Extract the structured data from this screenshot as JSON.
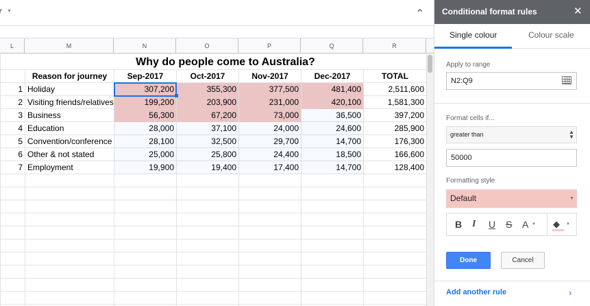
{
  "toolbar": {
    "collapse_icon": "chevron-up-icon"
  },
  "sheet": {
    "title": "Why do people come to Australia?",
    "columns": [
      "L",
      "M",
      "N",
      "O",
      "P",
      "Q",
      "R"
    ],
    "headers": {
      "reason": "Reason for journey",
      "n": "Sep-2017",
      "o": "Oct-2017",
      "p": "Nov-2017",
      "q": "Dec-2017",
      "r": "TOTAL"
    },
    "rows": [
      {
        "idx": "1",
        "reason": "Holiday",
        "n": "307,200",
        "o": "355,300",
        "p": "377,500",
        "q": "481,400",
        "r": "2,511,600"
      },
      {
        "idx": "2",
        "reason": "Visiting friends/relatives",
        "n": "199,200",
        "o": "203,900",
        "p": "231,000",
        "q": "420,100",
        "r": "1,581,300"
      },
      {
        "idx": "3",
        "reason": "Business",
        "n": "56,300",
        "o": "67,200",
        "p": "73,000",
        "q": "36,500",
        "r": "397,200"
      },
      {
        "idx": "4",
        "reason": "Education",
        "n": "28,000",
        "o": "37,100",
        "p": "24,000",
        "q": "24,600",
        "r": "285,900"
      },
      {
        "idx": "5",
        "reason": "Convention/conference",
        "n": "28,100",
        "o": "32,500",
        "p": "29,700",
        "q": "14,700",
        "r": "176,300"
      },
      {
        "idx": "6",
        "reason": "Other & not stated",
        "n": "25,000",
        "o": "25,800",
        "p": "24,400",
        "q": "18,500",
        "r": "166,600"
      },
      {
        "idx": "7",
        "reason": "Employment",
        "n": "19,900",
        "o": "19,400",
        "p": "17,400",
        "q": "14,700",
        "r": "128,400"
      }
    ],
    "highlight_color": "#f4c7c3",
    "selection_color": "#1a73e8"
  },
  "panel": {
    "title": "Conditional format rules",
    "close_icon": "close-icon",
    "tabs": [
      "Single colour",
      "Colour scale"
    ],
    "apply_label": "Apply to range",
    "range_value": "N2:Q9",
    "format_if_label": "Format cells if...",
    "condition": "greater than",
    "condition_value": "50000",
    "style_label": "Formatting style",
    "style_value": "Default",
    "style_color": "#f4c7c3",
    "format_buttons": {
      "bold": "B",
      "italic": "I",
      "underline": "U",
      "strike": "S",
      "text_color": "A"
    },
    "done": "Done",
    "cancel": "Cancel",
    "add_rule": "Add another rule"
  }
}
